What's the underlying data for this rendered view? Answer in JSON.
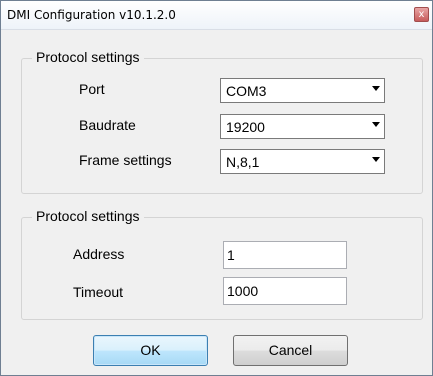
{
  "window": {
    "title": "DMI Configuration v10.1.2.0",
    "close_glyph": "x"
  },
  "group1": {
    "title": "Protocol settings",
    "port_label": "Port",
    "port_value": "COM3",
    "baudrate_label": "Baudrate",
    "baudrate_value": "19200",
    "frame_label": "Frame settings",
    "frame_value": "N,8,1"
  },
  "group2": {
    "title": "Protocol settings",
    "address_label": "Address",
    "address_value": "1",
    "timeout_label": "Timeout",
    "timeout_value": "1000"
  },
  "buttons": {
    "ok_label": "OK",
    "cancel_label": "Cancel"
  },
  "icons": {
    "dropdown": "chevron-down-icon",
    "close": "close-icon"
  }
}
